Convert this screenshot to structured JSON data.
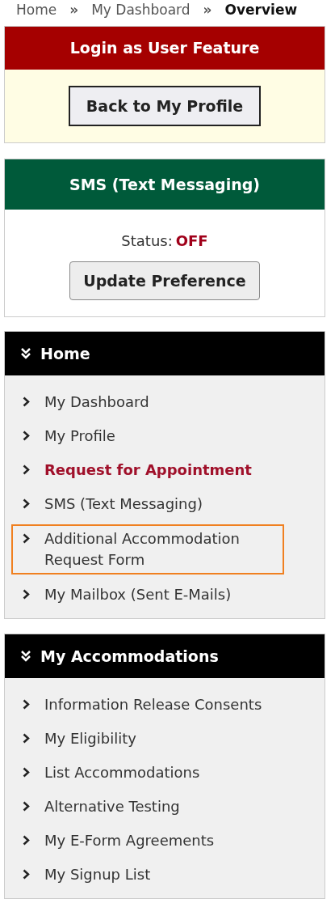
{
  "breadcrumb": [
    {
      "label": "Home",
      "current": false
    },
    {
      "label": "My Dashboard",
      "current": false
    },
    {
      "label": "Overview",
      "current": true
    }
  ],
  "breadcrumb_separator": "»",
  "login_panel": {
    "title": "Login as User Feature",
    "button": "Back to My Profile"
  },
  "sms_panel": {
    "title": "SMS (Text Messaging)",
    "status_label": "Status:",
    "status_value": "OFF",
    "on": false,
    "button": "Update Preference"
  },
  "menus": [
    {
      "title": "Home",
      "expanded": true,
      "items": [
        {
          "label": "My Dashboard",
          "emphasized": false,
          "outlined": false
        },
        {
          "label": "My Profile",
          "emphasized": false,
          "outlined": false
        },
        {
          "label": "Request for Appointment",
          "emphasized": true,
          "outlined": false
        },
        {
          "label": "SMS (Text Messaging)",
          "emphasized": false,
          "outlined": false
        },
        {
          "label": "Additional Accommodation Request Form",
          "emphasized": false,
          "outlined": true
        },
        {
          "label": "My Mailbox (Sent E-Mails)",
          "emphasized": false,
          "outlined": false
        }
      ]
    },
    {
      "title": "My Accommodations",
      "expanded": true,
      "items": [
        {
          "label": "Information Release Consents",
          "emphasized": false,
          "outlined": false
        },
        {
          "label": "My Eligibility",
          "emphasized": false,
          "outlined": false
        },
        {
          "label": "List Accommodations",
          "emphasized": false,
          "outlined": false
        },
        {
          "label": "Alternative Testing",
          "emphasized": false,
          "outlined": false
        },
        {
          "label": "My E-Form Agreements",
          "emphasized": false,
          "outlined": false
        },
        {
          "label": "My Signup List",
          "emphasized": false,
          "outlined": false
        }
      ]
    }
  ]
}
